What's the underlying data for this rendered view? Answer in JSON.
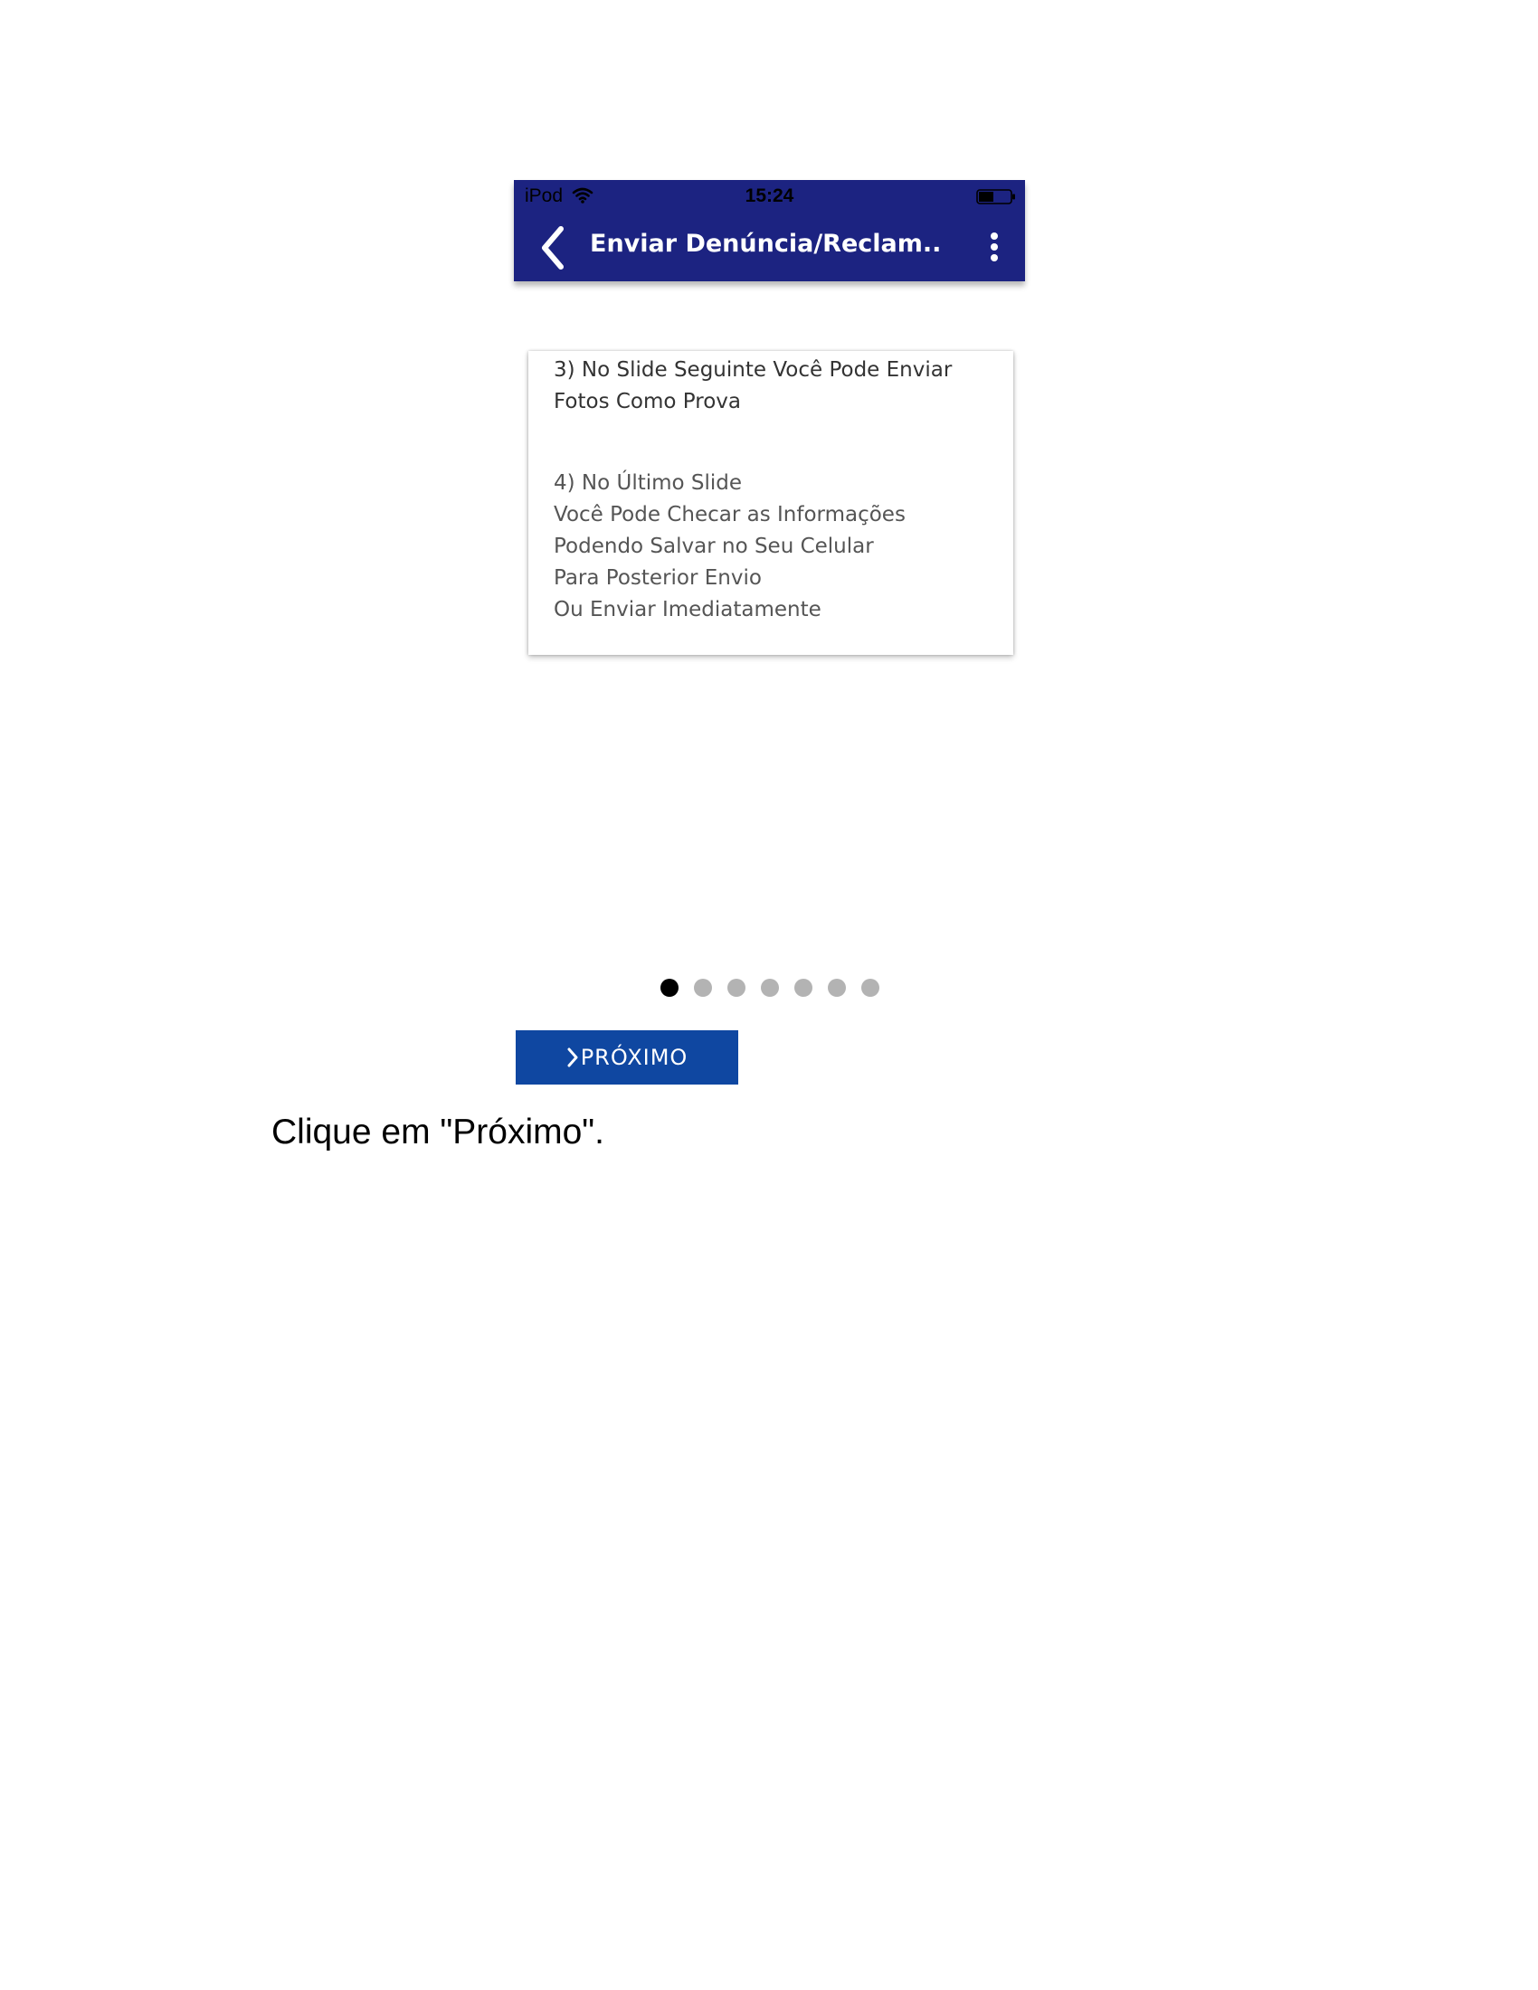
{
  "statusbar": {
    "device": "iPod",
    "time": "15:24",
    "wifi_icon": "wifi-icon",
    "battery_icon": "battery-icon"
  },
  "appbar": {
    "title": "Enviar Denúncia/Reclam...",
    "back_icon": "chevron-left-icon",
    "menu_icon": "more-vertical-icon",
    "background": "#1c2381"
  },
  "card": {
    "step3": [
      "3) No Slide Seguinte Você Pode Enviar",
      "Fotos Como Prova"
    ],
    "step4": [
      "4) No Último Slide",
      "Você Pode Checar as Informações",
      "Podendo Salvar no Seu Celular",
      "Para Posterior Envio",
      "Ou Enviar Imediatamente"
    ]
  },
  "pager": {
    "total": 7,
    "active_index": 0,
    "active_color": "#000000",
    "inactive_color": "#b3b3b3"
  },
  "next_button": {
    "label": "PRÓXIMO",
    "icon": "chevron-right-icon",
    "background": "#0f47a1"
  },
  "caption": "Clique em \"Próximo\"."
}
